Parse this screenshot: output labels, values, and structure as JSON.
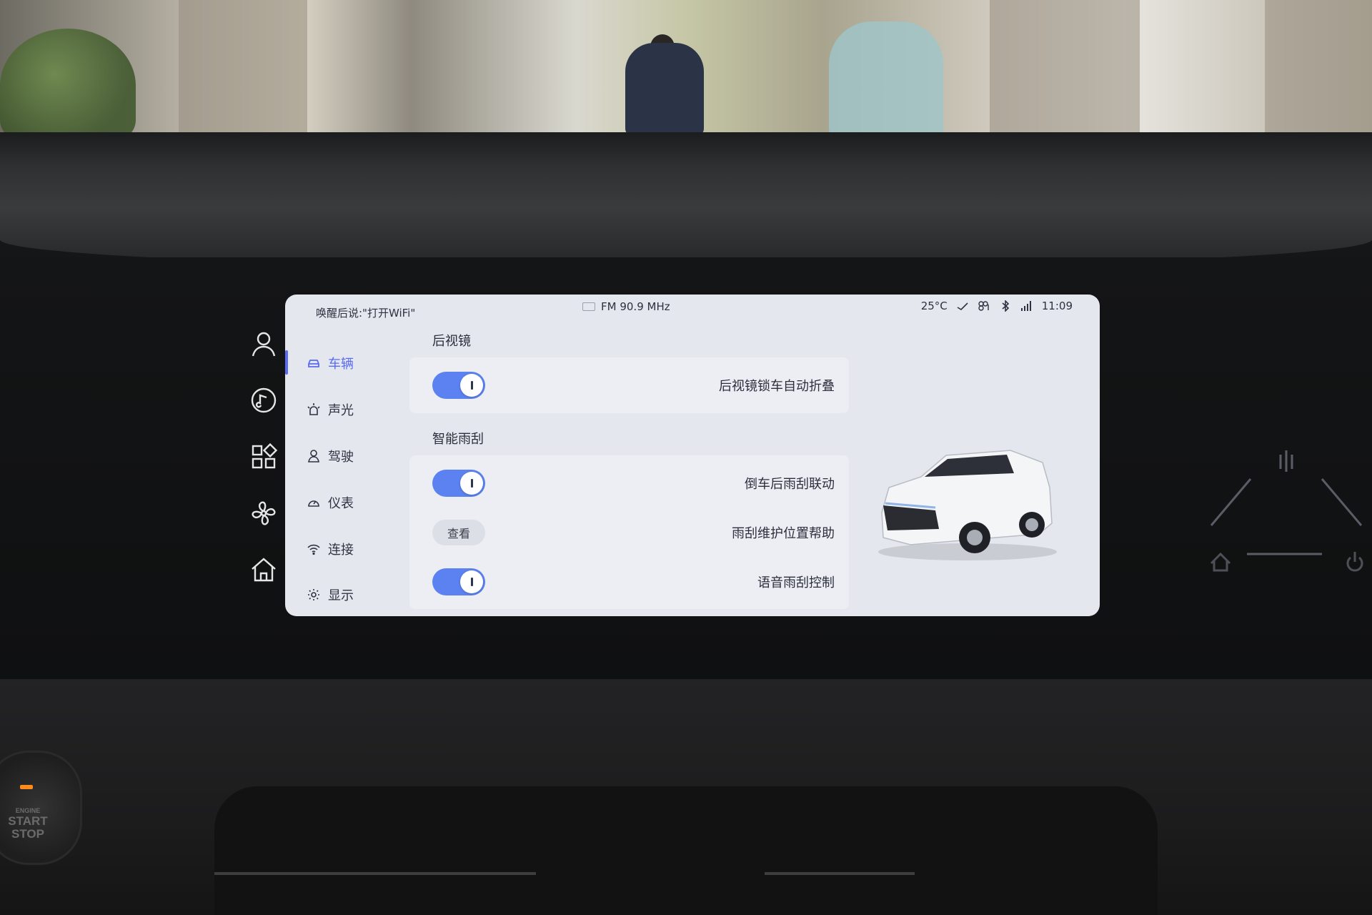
{
  "status_bar": {
    "voice_hint": "唤醒后说:\"打开WiFi\"",
    "radio": "FM 90.9 MHz",
    "temperature": "25°C",
    "time": "11:09",
    "icons": [
      "radio-icon",
      "weather-icon",
      "network-icon",
      "bluetooth-icon",
      "signal-icon"
    ]
  },
  "side_strip": {
    "icons": [
      "user-icon",
      "music-icon",
      "apps-icon",
      "fan-icon",
      "home-icon"
    ]
  },
  "nav": {
    "items": [
      {
        "label": "车辆",
        "icon": "car-icon",
        "active": true
      },
      {
        "label": "声光",
        "icon": "light-icon",
        "active": false
      },
      {
        "label": "驾驶",
        "icon": "driver-icon",
        "active": false
      },
      {
        "label": "仪表",
        "icon": "gauge-icon",
        "active": false
      },
      {
        "label": "连接",
        "icon": "wifi-icon",
        "active": false
      },
      {
        "label": "显示",
        "icon": "brightness-icon",
        "active": false
      }
    ]
  },
  "sections": {
    "mirror": {
      "title": "后视镜",
      "rows": [
        {
          "label": "后视镜锁车自动折叠",
          "control": "toggle",
          "on": true
        }
      ]
    },
    "wiper": {
      "title": "智能雨刮",
      "rows": [
        {
          "label": "倒车后雨刮联动",
          "control": "toggle",
          "on": true
        },
        {
          "label": "雨刮维护位置帮助",
          "control": "button",
          "button_label": "查看"
        },
        {
          "label": "语音雨刮控制",
          "control": "toggle",
          "on": true
        }
      ]
    }
  },
  "vehicle_image": "white-suv",
  "start_button": {
    "small": "ENGINE",
    "line1": "START",
    "line2": "STOP"
  },
  "colors": {
    "accent": "#5a6cf0",
    "toggle_on": "#5b82f0",
    "screen_bg": "#e4e7ee"
  }
}
